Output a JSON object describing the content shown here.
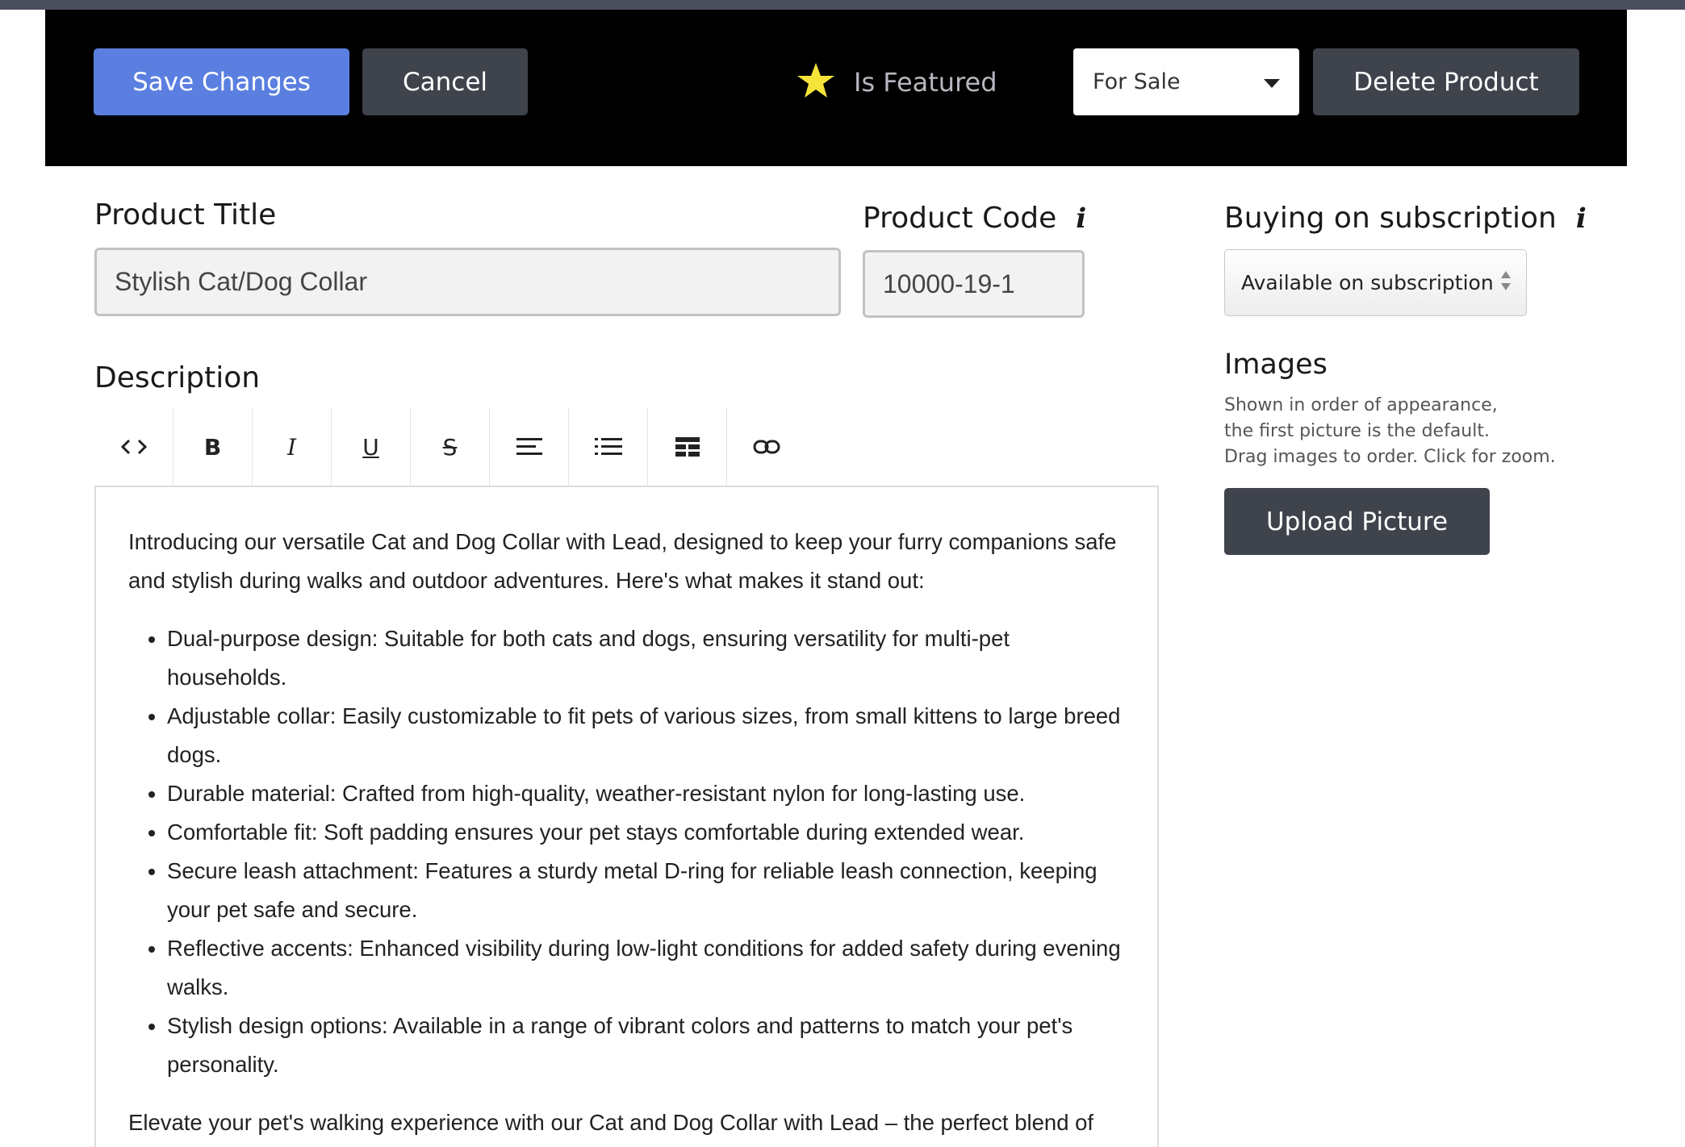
{
  "toolbar": {
    "save_label": "Save Changes",
    "cancel_label": "Cancel",
    "featured_label": "Is Featured",
    "status_value": "For Sale",
    "delete_label": "Delete Product"
  },
  "form": {
    "title_label": "Product Title",
    "title_value": "Stylish Cat/Dog Collar",
    "code_label": "Product Code",
    "code_value": "10000-19-1",
    "subscription_label": "Buying on subscription",
    "subscription_value": "Available on subscription",
    "description_label": "Description"
  },
  "images": {
    "heading": "Images",
    "help_lines": [
      "Shown in order of appearance,",
      "the first picture is the default.",
      "Drag images to order. Click for zoom."
    ],
    "upload_label": "Upload Picture"
  },
  "editor_toolbar": [
    "code-icon",
    "bold-icon",
    "italic-icon",
    "underline-icon",
    "strikethrough-icon",
    "align-icon",
    "list-icon",
    "table-icon",
    "link-icon"
  ],
  "description": {
    "intro": "Introducing our versatile Cat and Dog Collar with Lead, designed to keep your furry companions safe and stylish during walks and outdoor adventures. Here's what makes it stand out:",
    "bullets": [
      "Dual-purpose design: Suitable for both cats and dogs, ensuring versatility for multi-pet households.",
      "Adjustable collar: Easily customizable to fit pets of various sizes, from small kittens to large breed dogs.",
      "Durable material: Crafted from high-quality, weather-resistant nylon for long-lasting use.",
      "Comfortable fit: Soft padding ensures your pet stays comfortable during extended wear.",
      "Secure leash attachment: Features a sturdy metal D-ring for reliable leash connection, keeping your pet safe and secure.",
      "Reflective accents: Enhanced visibility during low-light conditions for added safety during evening walks.",
      "Stylish design options: Available in a range of vibrant colors and patterns to match your pet's personality."
    ],
    "outro": "Elevate your pet's walking experience with our Cat and Dog Collar with Lead – the perfect blend of"
  },
  "colors": {
    "save_button": "#5a7fe0",
    "dark_button": "#3f434c",
    "star": "#f5e33a",
    "toolbar_bg": "#000000"
  }
}
